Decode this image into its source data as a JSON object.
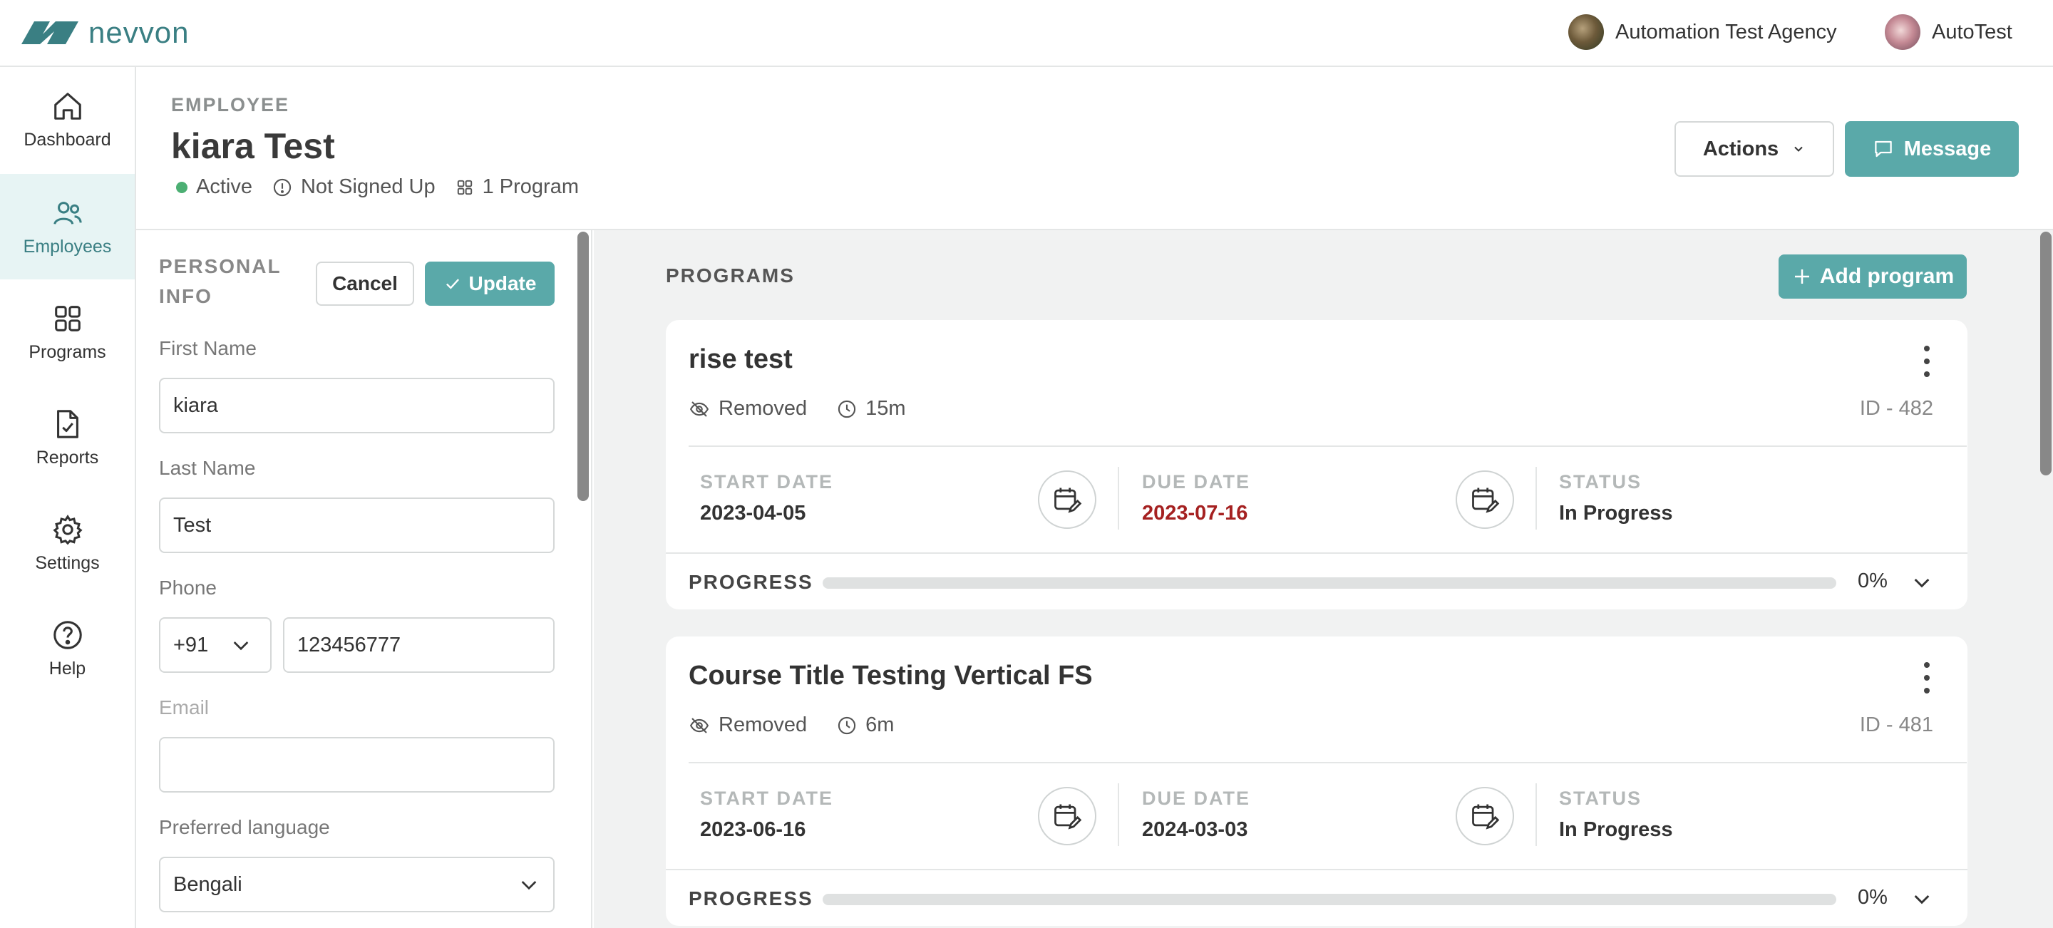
{
  "topbar": {
    "brand": "nevvon",
    "agency": "Automation Test Agency",
    "user": "AutoTest"
  },
  "sidebar": {
    "items": [
      {
        "label": "Dashboard",
        "icon": "home-icon"
      },
      {
        "label": "Employees",
        "icon": "users-icon",
        "active": true
      },
      {
        "label": "Programs",
        "icon": "grid-icon"
      },
      {
        "label": "Reports",
        "icon": "report-icon"
      },
      {
        "label": "Settings",
        "icon": "gear-icon"
      },
      {
        "label": "Help",
        "icon": "help-icon"
      }
    ]
  },
  "header": {
    "kicker": "EMPLOYEE",
    "name": "kiara Test",
    "status": "Active",
    "signup": "Not Signed Up",
    "programs": "1 Program",
    "actions_label": "Actions",
    "message_label": "Message"
  },
  "personal": {
    "title": "PERSONAL INFO",
    "cancel_label": "Cancel",
    "update_label": "Update",
    "first_name_label": "First Name",
    "first_name": "kiara",
    "last_name_label": "Last Name",
    "last_name": "Test",
    "phone_label": "Phone",
    "country_code": "+91",
    "phone": "123456777",
    "email_label": "Email",
    "email": "",
    "language_label": "Preferred language",
    "language": "Bengali"
  },
  "programs": {
    "title": "PROGRAMS",
    "add_label": "Add program",
    "start_label": "START DATE",
    "due_label": "DUE DATE",
    "status_label": "STATUS",
    "progress_label": "PROGRESS",
    "items": [
      {
        "title": "rise test",
        "visibility": "Removed",
        "duration": "15m",
        "id": "ID - 482",
        "start": "2023-04-05",
        "due": "2023-07-16",
        "due_overdue": true,
        "status": "In Progress",
        "progress": 0,
        "progress_text": "0%"
      },
      {
        "title": "Course Title Testing Vertical FS",
        "visibility": "Removed",
        "duration": "6m",
        "id": "ID - 481",
        "start": "2023-06-16",
        "due": "2024-03-03",
        "due_overdue": false,
        "status": "In Progress",
        "progress": 0,
        "progress_text": "0%"
      }
    ]
  },
  "colors": {
    "accent": "#5aa9a9",
    "brand": "#3a7f83",
    "overdue": "#a52121",
    "active_dot": "#4caf73"
  }
}
